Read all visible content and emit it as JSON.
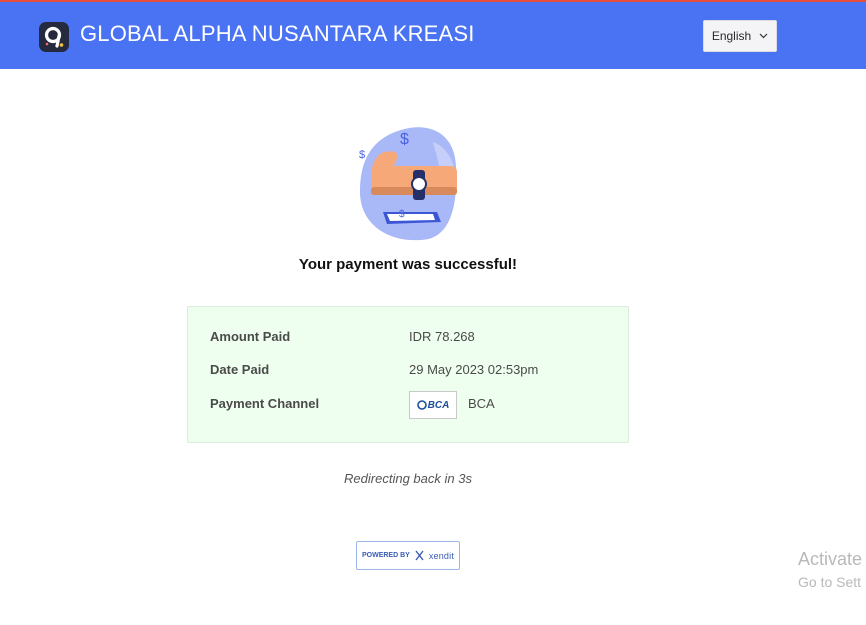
{
  "header": {
    "brand": "GLOBAL ALPHA NUSANTARA KREASI",
    "language": "English",
    "background_color": "#4a73f4"
  },
  "status": {
    "message": "Your payment was successful!"
  },
  "payment": {
    "rows": [
      {
        "label": "Amount Paid",
        "value": "IDR 78.268"
      },
      {
        "label": "Date Paid",
        "value": "29 May 2023 02:53pm"
      },
      {
        "label": "Payment Channel",
        "value": "BCA",
        "logo_text": "BCA"
      }
    ]
  },
  "redirect": {
    "text": "Redirecting back in 3s"
  },
  "footer": {
    "powered_by": "POWERED BY",
    "provider": "xendit"
  },
  "watermark": {
    "line1": "Activate",
    "line2": "Go to Sett"
  }
}
